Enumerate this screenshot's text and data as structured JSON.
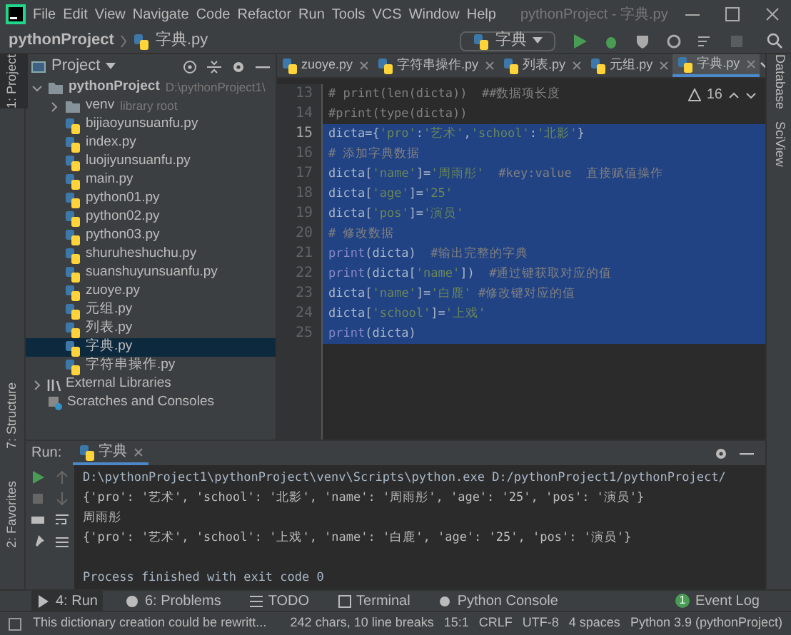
{
  "menu_bar": {
    "items": [
      "File",
      "Edit",
      "View",
      "Navigate",
      "Code",
      "Refactor",
      "Run",
      "Tools",
      "VCS",
      "Window",
      "Help"
    ],
    "title": "pythonProject - 字典.py"
  },
  "nav_bar": {
    "breadcrumbs": [
      "pythonProject",
      "字典.py"
    ],
    "run_config": "字典"
  },
  "left_strip": [
    "1: Project",
    "7: Structure",
    "2: Favorites"
  ],
  "right_strip": [
    "Database",
    "SciView"
  ],
  "project_panel": {
    "title": "Project",
    "tree": [
      {
        "label": "pythonProject",
        "hint": "D:\\pythonProject1\\",
        "kind": "folder",
        "expanded": true,
        "selected": false,
        "children": [
          {
            "label": "venv",
            "hint": "library root",
            "kind": "folder",
            "expanded": false,
            "selected": false
          },
          {
            "label": "bijiaoyunsuanfu.py",
            "kind": "file",
            "selected": false
          },
          {
            "label": "index.py",
            "kind": "file",
            "selected": false
          },
          {
            "label": "luojiyunsuanfu.py",
            "kind": "file",
            "selected": false
          },
          {
            "label": "main.py",
            "kind": "file",
            "selected": false
          },
          {
            "label": "python01.py",
            "kind": "file",
            "selected": false
          },
          {
            "label": "python02.py",
            "kind": "file",
            "selected": false
          },
          {
            "label": "python03.py",
            "kind": "file",
            "selected": false
          },
          {
            "label": "shuruheshuchu.py",
            "kind": "file",
            "selected": false
          },
          {
            "label": "suanshuyunsuanfu.py",
            "kind": "file",
            "selected": false
          },
          {
            "label": "zuoye.py",
            "kind": "file",
            "selected": false
          },
          {
            "label": "元组.py",
            "kind": "file",
            "selected": false
          },
          {
            "label": "列表.py",
            "kind": "file",
            "selected": false
          },
          {
            "label": "字典.py",
            "kind": "file",
            "selected": true
          },
          {
            "label": "字符串操作.py",
            "kind": "file",
            "selected": false
          }
        ]
      },
      {
        "label": "External Libraries",
        "kind": "library",
        "expanded": false,
        "selected": false
      },
      {
        "label": "Scratches and Consoles",
        "kind": "scratches",
        "selected": false
      }
    ]
  },
  "editor_tabs": [
    {
      "label": "zuoye.py",
      "selected": false
    },
    {
      "label": "字符串操作.py",
      "selected": false
    },
    {
      "label": "列表.py",
      "selected": false
    },
    {
      "label": "元组.py",
      "selected": false
    },
    {
      "label": "字典.py",
      "selected": true
    }
  ],
  "inspection": {
    "warnings": "16"
  },
  "code_lines": [
    {
      "number": "13",
      "selected": false,
      "tokens": [
        {
          "text": "# print(len(dicta))  ##数据项长度",
          "kind": "comment"
        }
      ]
    },
    {
      "number": "14",
      "selected": false,
      "tokens": [
        {
          "text": "#print(type(dicta))",
          "kind": "comment"
        }
      ]
    },
    {
      "number": "15",
      "selected": true,
      "tokens": [
        {
          "text": "dicta={",
          "kind": "code"
        },
        {
          "text": "'pro'",
          "kind": "string"
        },
        {
          "text": ":",
          "kind": "code"
        },
        {
          "text": "'艺术'",
          "kind": "string"
        },
        {
          "text": ",",
          "kind": "code"
        },
        {
          "text": "'school'",
          "kind": "string"
        },
        {
          "text": ":",
          "kind": "code"
        },
        {
          "text": "'北影'",
          "kind": "string"
        },
        {
          "text": "}",
          "kind": "code"
        }
      ]
    },
    {
      "number": "16",
      "selected": true,
      "tokens": [
        {
          "text": "# 添加字典数据",
          "kind": "comment"
        }
      ]
    },
    {
      "number": "17",
      "selected": true,
      "tokens": [
        {
          "text": "dicta[",
          "kind": "code"
        },
        {
          "text": "'name'",
          "kind": "string"
        },
        {
          "text": "]=",
          "kind": "code"
        },
        {
          "text": "'周雨彤'",
          "kind": "string"
        },
        {
          "text": "  #key:value  直接赋值操作",
          "kind": "comment"
        }
      ]
    },
    {
      "number": "18",
      "selected": true,
      "tokens": [
        {
          "text": "dicta[",
          "kind": "code"
        },
        {
          "text": "'age'",
          "kind": "string"
        },
        {
          "text": "]=",
          "kind": "code"
        },
        {
          "text": "'25'",
          "kind": "string"
        }
      ]
    },
    {
      "number": "19",
      "selected": true,
      "tokens": [
        {
          "text": "dicta[",
          "kind": "code"
        },
        {
          "text": "'pos'",
          "kind": "string"
        },
        {
          "text": "]=",
          "kind": "code"
        },
        {
          "text": "'演员'",
          "kind": "string"
        }
      ]
    },
    {
      "number": "20",
      "selected": true,
      "tokens": [
        {
          "text": "# 修改数据",
          "kind": "comment"
        }
      ]
    },
    {
      "number": "21",
      "selected": true,
      "tokens": [
        {
          "text": "print",
          "kind": "builtin"
        },
        {
          "text": "(dicta)  ",
          "kind": "code"
        },
        {
          "text": "#输出完整的字典",
          "kind": "comment"
        }
      ]
    },
    {
      "number": "22",
      "selected": true,
      "tokens": [
        {
          "text": "print",
          "kind": "builtin"
        },
        {
          "text": "(dicta[",
          "kind": "code"
        },
        {
          "text": "'name'",
          "kind": "string"
        },
        {
          "text": "])  ",
          "kind": "code"
        },
        {
          "text": "#通过键获取对应的值",
          "kind": "comment"
        }
      ]
    },
    {
      "number": "23",
      "selected": true,
      "tokens": [
        {
          "text": "dicta[",
          "kind": "code"
        },
        {
          "text": "'name'",
          "kind": "string"
        },
        {
          "text": "]=",
          "kind": "code"
        },
        {
          "text": "'白鹿'",
          "kind": "string"
        },
        {
          "text": " #修改键对应的值",
          "kind": "comment"
        }
      ]
    },
    {
      "number": "24",
      "selected": true,
      "tokens": [
        {
          "text": "dicta[",
          "kind": "code"
        },
        {
          "text": "'school'",
          "kind": "string"
        },
        {
          "text": "]=",
          "kind": "code"
        },
        {
          "text": "'上戏'",
          "kind": "string"
        }
      ]
    },
    {
      "number": "25",
      "selected": true,
      "tokens": [
        {
          "text": "print",
          "kind": "builtin"
        },
        {
          "text": "(dicta)",
          "kind": "code"
        }
      ]
    }
  ],
  "run_panel": {
    "label": "Run:",
    "tab": "字典",
    "output": [
      {
        "text": "D:\\pythonProject1\\pythonProject\\venv\\Scripts\\python.exe D:/pythonProject1/pythonProject/",
        "kind": "command"
      },
      {
        "text": "{'pro': '艺术', 'school': '北影', 'name': '周雨彤', 'age': '25', 'pos': '演员'}",
        "kind": "stdout"
      },
      {
        "text": "周雨彤",
        "kind": "stdout"
      },
      {
        "text": "{'pro': '艺术', 'school': '上戏', 'name': '白鹿', 'age': '25', 'pos': '演员'}",
        "kind": "stdout"
      },
      {
        "text": "Process finished with exit code 0",
        "kind": "exit"
      }
    ]
  },
  "tool_windows": [
    {
      "label": "4: Run",
      "kind": "run",
      "selected": true
    },
    {
      "label": "6: Problems",
      "kind": "problems",
      "selected": false
    },
    {
      "label": "TODO",
      "kind": "todo",
      "selected": false
    },
    {
      "label": "Terminal",
      "kind": "terminal",
      "selected": false
    },
    {
      "label": "Python Console",
      "kind": "console",
      "selected": false
    }
  ],
  "event_log": {
    "label": "Event Log",
    "count": "1"
  },
  "status_bar": {
    "message": "This dictionary creation could be rewritt...",
    "items": [
      "242 chars, 10 line breaks",
      "15:1",
      "CRLF",
      "UTF-8",
      "4 spaces",
      "Python 3.9 (pythonProject)"
    ]
  }
}
